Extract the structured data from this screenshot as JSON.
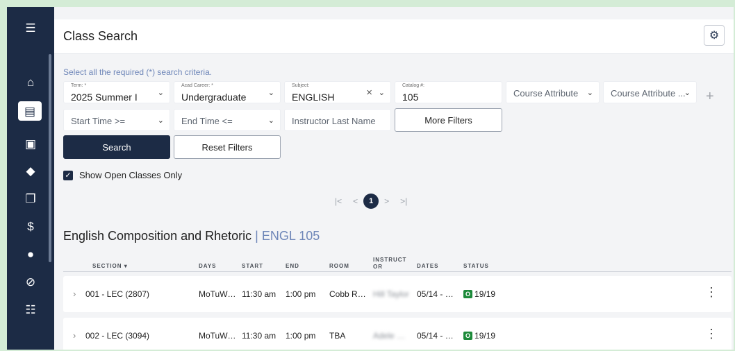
{
  "sidebar": {
    "items": [
      {
        "icon": "menu-icon",
        "glyph": "☰"
      },
      {
        "icon": "home-icon",
        "glyph": "⌂"
      },
      {
        "icon": "class-search-icon",
        "glyph": "▤"
      },
      {
        "icon": "calendar-icon",
        "glyph": "▣"
      },
      {
        "icon": "graduation-cap-icon",
        "glyph": "◆"
      },
      {
        "icon": "documents-icon",
        "glyph": "❐"
      },
      {
        "icon": "dollar-icon",
        "glyph": "$"
      },
      {
        "icon": "piggy-bank-icon",
        "glyph": "●"
      },
      {
        "icon": "prohibited-icon",
        "glyph": "⊘"
      },
      {
        "icon": "checklist-icon",
        "glyph": "☷"
      }
    ]
  },
  "header": {
    "title": "Class Search",
    "settings_icon": "gear-icon",
    "settings_glyph": "⚙"
  },
  "search": {
    "hint": "Select all the required (*) search criteria.",
    "term": {
      "label": "Term: *",
      "value": "2025 Summer I"
    },
    "career": {
      "label": "Acad Career: *",
      "value": "Undergraduate"
    },
    "subject": {
      "label": "Subject:",
      "value": "ENGLISH"
    },
    "catalog": {
      "label": "Catalog #:",
      "value": "105"
    },
    "attribute": {
      "placeholder": "Course Attribute"
    },
    "attribute_value": {
      "placeholder": "Course Attribute ..."
    },
    "start_time": {
      "placeholder": "Start Time >="
    },
    "end_time": {
      "placeholder": "End Time <="
    },
    "instructor": {
      "placeholder": "Instructor Last Name"
    },
    "more_filters_label": "More Filters",
    "search_label": "Search",
    "reset_label": "Reset Filters",
    "add_glyph": "+",
    "open_only_label": "Show Open Classes Only",
    "open_only_checked": true
  },
  "pagination": {
    "first": "|<",
    "prev": "<",
    "current": "1",
    "next": ">",
    "last": ">|"
  },
  "course": {
    "name": "English Composition and Rhetoric",
    "separator": " | ",
    "code": "ENGL 105"
  },
  "table": {
    "headers": {
      "section": "SECTION ▾",
      "days": "DAYS",
      "start": "START",
      "end": "END",
      "room": "ROOM",
      "instructor_line1": "INSTRUCT",
      "instructor_line2": "OR",
      "dates": "DATES",
      "status": "STATUS"
    },
    "rows": [
      {
        "section": "001 - LEC (2807)",
        "days": "MoTuW…",
        "start": "11:30 am",
        "end": "1:00 pm",
        "room": "Cobb R…",
        "instructor": "Hill Taylor",
        "dates": "05/14 - …",
        "status_badge": "O",
        "status": "19/19"
      },
      {
        "section": "002 - LEC (3094)",
        "days": "MoTuW…",
        "start": "11:30 am",
        "end": "1:00 pm",
        "room": "TBA",
        "instructor": "Adele …",
        "dates": "05/14 - …",
        "status_badge": "O",
        "status": "19/19"
      }
    ]
  },
  "colors": {
    "brand_navy": "#1c2b45",
    "status_open": "#1d8a3a",
    "link_blue": "#6e86b8"
  }
}
